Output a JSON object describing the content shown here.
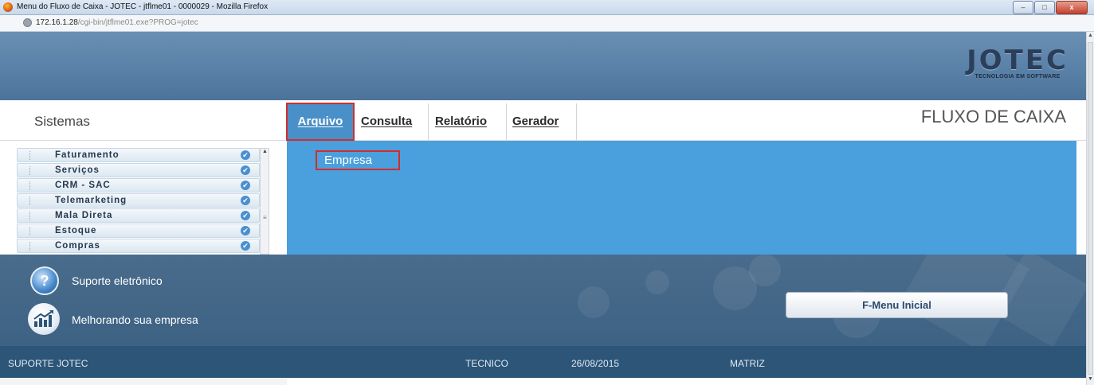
{
  "window": {
    "title": "Menu do Fluxo de Caixa - JOTEC - jtflme01 - 0000029 - Mozilla Firefox",
    "url_host": "172.16.1.28",
    "url_path": "/cgi-bin/jtflme01.exe?PROG=jotec",
    "minimize": "–",
    "maximize": "□",
    "close": "x"
  },
  "logo": {
    "word": "JOTEC",
    "tagline": "TECNOLOGIA EM SOFTWARE"
  },
  "menubar": {
    "sistemas": "Sistemas",
    "items": [
      "Arquivo",
      "Consulta",
      "Relatório",
      "Gerador"
    ],
    "module_title": "FLUXO DE CAIXA"
  },
  "dropdown": {
    "items": [
      "Empresa"
    ]
  },
  "sidebar": {
    "items": [
      {
        "label": "Faturamento"
      },
      {
        "label": "Serviços"
      },
      {
        "label": "CRM - SAC"
      },
      {
        "label": "Telemarketing"
      },
      {
        "label": "Mala Direta"
      },
      {
        "label": "Estoque"
      },
      {
        "label": "Compras"
      }
    ]
  },
  "footer": {
    "support_text": "Suporte eletrônico",
    "improve_text": "Melhorando sua empresa",
    "menu_button": "F-Menu Inicial"
  },
  "status": {
    "user": "SUPORTE JOTEC",
    "role": "TECNICO",
    "date": "26/08/2015",
    "branch": "MATRIZ"
  },
  "colors": {
    "menu_active": "#4a90c8",
    "content_blue": "#4aa0dc",
    "highlight_red": "#d42c2c",
    "status_bar": "#2c5578"
  }
}
